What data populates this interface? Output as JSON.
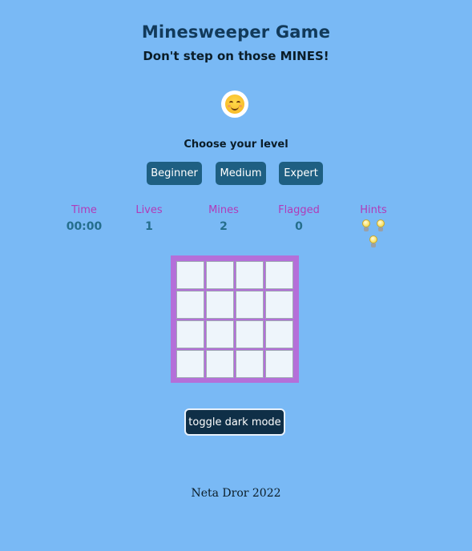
{
  "header": {
    "title": "Minesweeper Game",
    "subtitle": "Don't step on those MINES!"
  },
  "smiley": {
    "icon": "smiling-face-icon"
  },
  "levels": {
    "prompt": "Choose your level",
    "options": [
      "Beginner",
      "Medium",
      "Expert"
    ]
  },
  "stats": {
    "time": {
      "label": "Time",
      "value": "00:00"
    },
    "lives": {
      "label": "Lives",
      "value": "1"
    },
    "mines": {
      "label": "Mines",
      "value": "2"
    },
    "flagged": {
      "label": "Flagged",
      "value": "0"
    },
    "hints": {
      "label": "Hints",
      "count": 3,
      "icon": "lightbulb-icon"
    }
  },
  "board": {
    "rows": 4,
    "cols": 4,
    "cells_state": "unrevealed",
    "border_color": "#b46fd9",
    "cell_color": "#eef5fb"
  },
  "controls": {
    "dark_mode_label": "toggle dark mode"
  },
  "footer": {
    "credit": "Neta Dror 2022"
  },
  "colors": {
    "background": "#79b9f5",
    "button": "#1e5f82",
    "stat_label": "#b03bb8",
    "stat_value": "#256e8c"
  }
}
